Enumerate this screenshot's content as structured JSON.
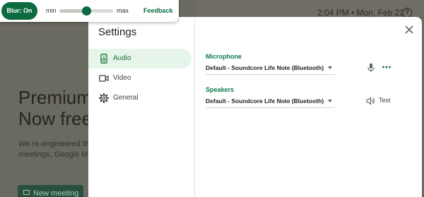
{
  "blur_toolbar": {
    "toggle_label": "Blur: On",
    "slider_min_label": "min",
    "slider_max_label": "max",
    "slider_value": 0.5,
    "feedback_label": "Feedback"
  },
  "background": {
    "clock": "2:04 PM • Mon, Feb 22",
    "hero_title_lines": [
      "Premium",
      "Now free"
    ],
    "hero_desc_lines": [
      "We re-engineered th",
      "meetings, Google M"
    ],
    "new_meeting_label": "New meeting"
  },
  "settings": {
    "title": "Settings",
    "nav": [
      {
        "label": "Audio",
        "icon": "speaker-device-icon",
        "active": true
      },
      {
        "label": "Video",
        "icon": "video-camera-icon",
        "active": false
      },
      {
        "label": "General",
        "icon": "gear-icon",
        "active": false
      }
    ],
    "microphone": {
      "label": "Microphone",
      "selected": "Default - Soundcore Life Note (Bluetooth)"
    },
    "speakers": {
      "label": "Speakers",
      "selected": "Default - Soundcore Life Note (Bluetooth)",
      "test_label": "Test"
    }
  },
  "colors": {
    "brand_green": "#0c6b3f",
    "section_label_green": "#0d7a4b",
    "active_nav_bg": "#e6f4ea"
  }
}
